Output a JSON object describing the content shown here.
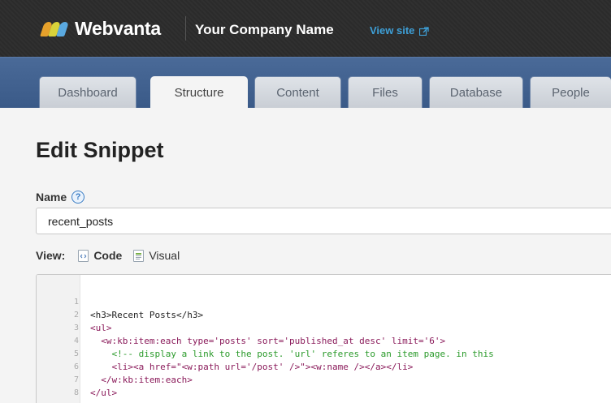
{
  "header": {
    "brand": "Webvanta",
    "company": "Your Company Name",
    "view_site": "View site",
    "logo_colors": [
      "#e6a12b",
      "#d8d23a",
      "#5aa9e0"
    ]
  },
  "nav": {
    "tabs": [
      {
        "label": "Dashboard",
        "active": false
      },
      {
        "label": "Structure",
        "active": true
      },
      {
        "label": "Content",
        "active": false
      },
      {
        "label": "Files",
        "active": false
      },
      {
        "label": "Database",
        "active": false
      },
      {
        "label": "People",
        "active": false
      }
    ]
  },
  "page": {
    "title": "Edit Snippet",
    "name_label": "Name",
    "help_glyph": "?",
    "name_value": "recent_posts",
    "view_label": "View:",
    "view_code": "Code",
    "view_visual": "Visual"
  },
  "editor": {
    "line_numbers": [
      "1",
      "2",
      "3",
      "4",
      "5",
      "6",
      "7",
      "8"
    ],
    "lines": [
      "<h3>Recent Posts</h3>",
      "<ul>",
      "  <w:kb:item:each type='posts' sort='published_at desc' limit='6'>",
      "    <!-- display a link to the post. 'url' referes to an item page. in this",
      "    <li><a href=\"<w:path url='/post' />\"><w:name /></a></li>",
      "  </w:kb:item:each>",
      "</ul>",
      ""
    ]
  },
  "colors": {
    "topbar": "#2b2b2b",
    "nav": "#3f5f8f",
    "link": "#3ea0d8"
  }
}
